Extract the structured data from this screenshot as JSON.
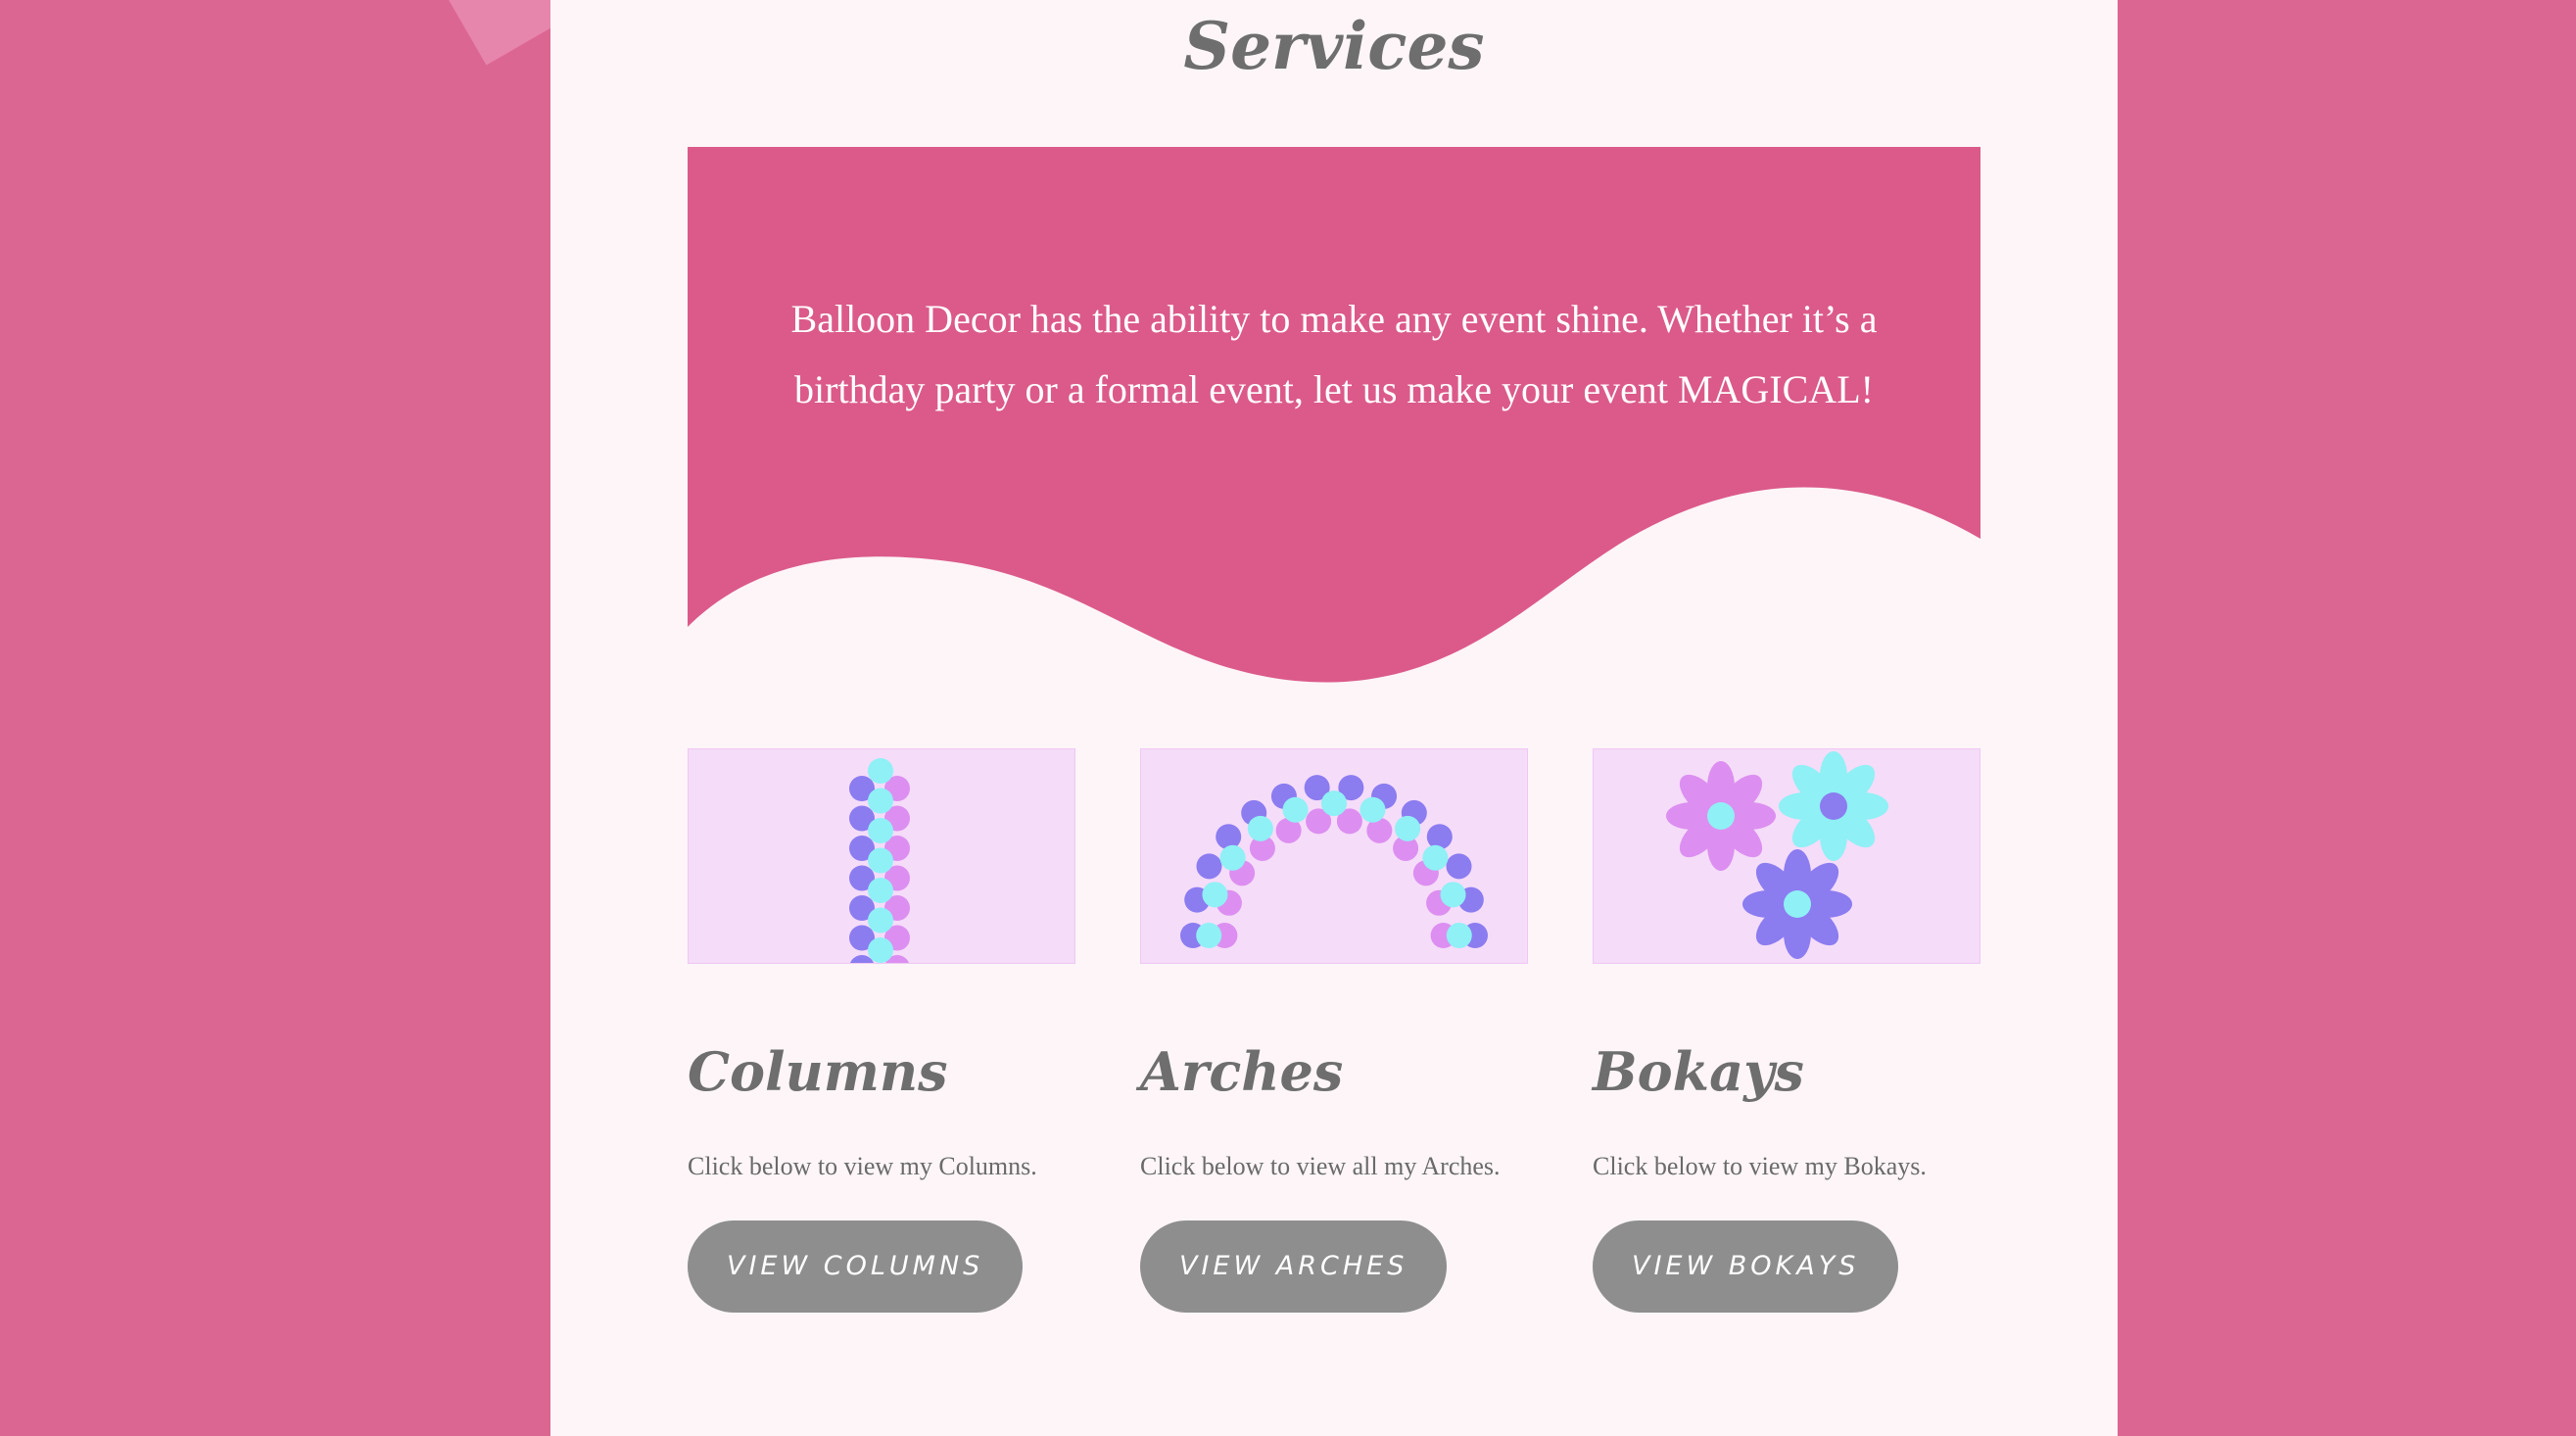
{
  "section": {
    "title": "Services"
  },
  "banner": {
    "text": "Balloon Decor has the ability to make any event shine. Whether it’s a birthday party or a formal event, let us make your event MAGICAL!"
  },
  "cards": [
    {
      "name": "Columns",
      "description": "Click below to view my Columns.",
      "button": "VIEW COLUMNS"
    },
    {
      "name": "Arches",
      "description": "Click below to view all my Arches.",
      "button": "VIEW ARCHES"
    },
    {
      "name": "Bokays",
      "description": "Click below to view my Bokays.",
      "button": "VIEW BOKAYS"
    }
  ],
  "colors": {
    "page_background": "#dc6692",
    "panel": "#fdf5f8",
    "banner": "#db5a8a",
    "card_image_bg": "#f5dcf9",
    "balloon_violet": "#8b7cf0",
    "balloon_pink": "#dc8ff0",
    "balloon_cyan": "#8ff0f5",
    "button": "#8e8e8e"
  }
}
